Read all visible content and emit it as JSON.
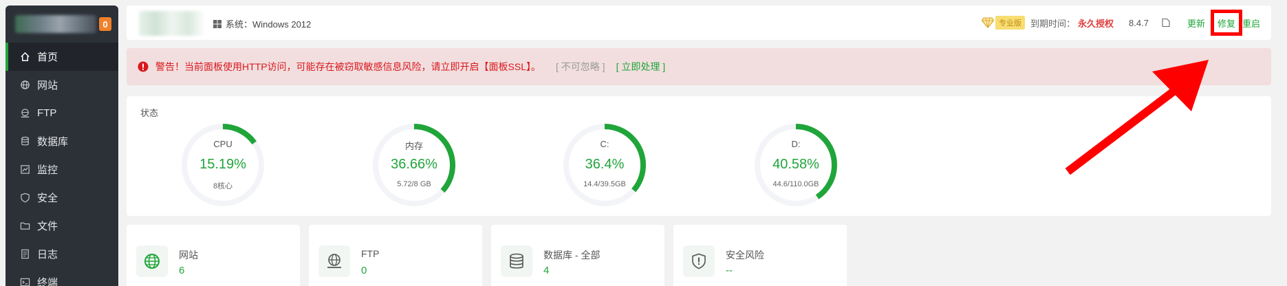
{
  "sidebar": {
    "badge_count": "0",
    "items": [
      {
        "label": "首页",
        "icon": "home-icon"
      },
      {
        "label": "网站",
        "icon": "globe-icon"
      },
      {
        "label": "FTP",
        "icon": "ftp-icon"
      },
      {
        "label": "数据库",
        "icon": "database-icon"
      },
      {
        "label": "监控",
        "icon": "monitor-icon"
      },
      {
        "label": "安全",
        "icon": "shield-icon"
      },
      {
        "label": "文件",
        "icon": "folder-icon"
      },
      {
        "label": "日志",
        "icon": "log-icon"
      },
      {
        "label": "终端",
        "icon": "terminal-icon"
      }
    ],
    "active_index": 0
  },
  "topbar": {
    "system_label": "系统：Windows 2012",
    "pro_badge": "专业版",
    "expire_label": "到期时间：",
    "expire_value": "永久授权",
    "version": "8.4.7",
    "update_label": "更新",
    "repair_label": "修复",
    "restart_label": "重启"
  },
  "alert": {
    "text": "警告！当前面板使用HTTP访问，可能存在被窃取敏感信息风险，请立即开启【面板SSL】。",
    "ignore_label": "[ 不可忽略 ]",
    "handle_label": "[ 立即处理 ]"
  },
  "status": {
    "title": "状态",
    "gauges": [
      {
        "label": "CPU",
        "value": "15.19%",
        "percent": 15.19,
        "sub": "8核心"
      },
      {
        "label": "内存",
        "value": "36.66%",
        "percent": 36.66,
        "sub": "5.72/8 GB"
      },
      {
        "label": "C:",
        "value": "36.4%",
        "percent": 36.4,
        "sub": "14.4/39.5GB"
      },
      {
        "label": "D:",
        "value": "40.58%",
        "percent": 40.58,
        "sub": "44.6/110.0GB"
      }
    ]
  },
  "cards": [
    {
      "title": "网站",
      "value": "6",
      "icon": "globe-icon"
    },
    {
      "title": "FTP",
      "value": "0",
      "icon": "ftp-icon"
    },
    {
      "title": "数据库 - 全部",
      "value": "4",
      "icon": "database-icon"
    },
    {
      "title": "安全风险",
      "value": "--",
      "icon": "shield-icon"
    }
  ],
  "colors": {
    "accent": "#20a53a",
    "danger": "#d9181e",
    "annotation": "#ff0000",
    "sidebar": "#2c3138"
  }
}
